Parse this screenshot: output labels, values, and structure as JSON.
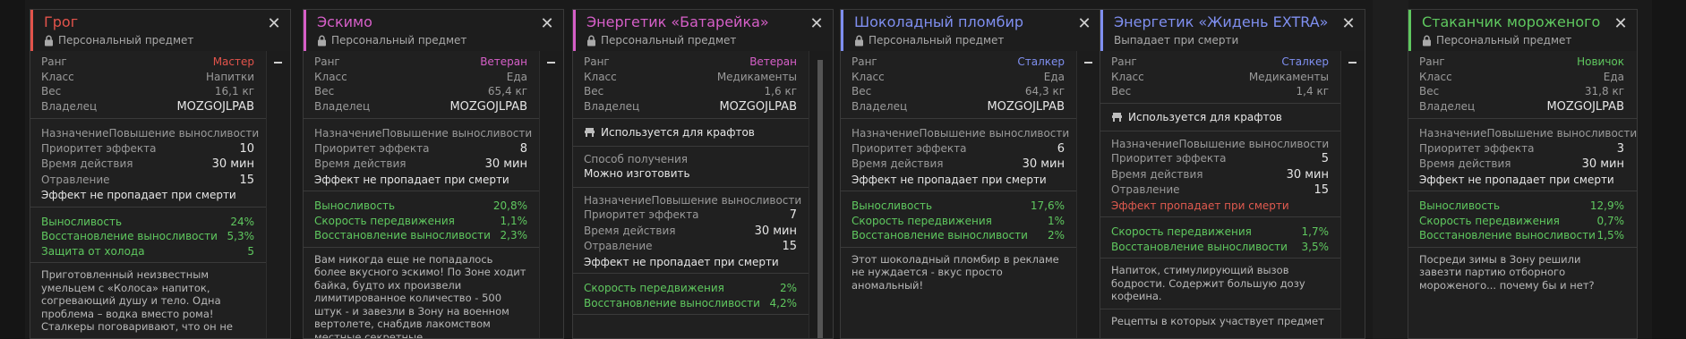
{
  "cards": [
    {
      "title": "Грог",
      "subtitle": "Персональный предмет",
      "accent": "#e2534b",
      "rank": {
        "key": "Ранг",
        "value": "Мастер",
        "color": "#e2534b"
      },
      "klass": {
        "key": "Класс",
        "value": "Напитки"
      },
      "weight": {
        "key": "Вес",
        "value": "16,1 кг"
      },
      "owner": {
        "key": "Владелец",
        "value": "MOZGOJLPAB"
      },
      "purpose": {
        "key": "Назначение",
        "value": "Повышение выносливости"
      },
      "priority": {
        "key": "Приоритет эффекта",
        "value": "10"
      },
      "duration": {
        "key": "Время действия",
        "value": "30 мин"
      },
      "poison": {
        "key": "Отравление",
        "value": "15"
      },
      "note": "Эффект не пропадает при смерти",
      "stats": [
        {
          "key": "Выносливость",
          "value": "24%"
        },
        {
          "key": "Восстановление выносливости",
          "value": "5,3%"
        },
        {
          "key": "Защита от холода",
          "value": "5"
        }
      ],
      "desc": "Приготовленный неизвестным умельцем с «Колоса» напиток, согревающий душу и тело. Одна проблема – водка вместо рома! Сталкеры поговаривают, что он не"
    },
    {
      "title": "Эскимо",
      "subtitle": "Персональный предмет",
      "accent": "#d65fc8",
      "rank": {
        "key": "Ранг",
        "value": "Ветеран",
        "color": "#d65fc8"
      },
      "klass": {
        "key": "Класс",
        "value": "Еда"
      },
      "weight": {
        "key": "Вес",
        "value": "65,4 кг"
      },
      "owner": {
        "key": "Владелец",
        "value": "MOZGOJLPAB"
      },
      "purpose": {
        "key": "Назначение",
        "value": "Повышение выносливости"
      },
      "priority": {
        "key": "Приоритет эффекта",
        "value": "8"
      },
      "duration": {
        "key": "Время действия",
        "value": "30 мин"
      },
      "note": "Эффект не пропадает при смерти",
      "stats": [
        {
          "key": "Выносливость",
          "value": "20,8%"
        },
        {
          "key": "Скорость передвижения",
          "value": "1,1%"
        },
        {
          "key": "Восстановление выносливости",
          "value": "2,3%"
        }
      ],
      "desc": "Вам никогда еще не попадалось более вкусного эскимо! По Зоне ходит байка, будто их произвели лимитированное количество - 500 штук - и завезли в Зону на военном вертолете, снабдив лакомством местные секретные"
    },
    {
      "title": "Энергетик «Батарейка»",
      "subtitle": "Персональный предмет",
      "accent": "#d65fc8",
      "rank": {
        "key": "Ранг",
        "value": "Ветеран",
        "color": "#d65fc8"
      },
      "klass": {
        "key": "Класс",
        "value": "Медикаменты"
      },
      "weight": {
        "key": "Вес",
        "value": "1,6 кг"
      },
      "owner": {
        "key": "Владелец",
        "value": "MOZGOJLPAB"
      },
      "craft": "Используется для крафтов",
      "obtain": {
        "label": "Способ получения",
        "value": "Можно изготовить"
      },
      "purpose": {
        "key": "Назначение",
        "value": "Повышение выносливости"
      },
      "priority": {
        "key": "Приоритет эффекта",
        "value": "7"
      },
      "duration": {
        "key": "Время действия",
        "value": "30 мин"
      },
      "poison": {
        "key": "Отравление",
        "value": "15"
      },
      "note": "Эффект не пропадает при смерти",
      "stats": [
        {
          "key": "Скорость передвижения",
          "value": "2%"
        },
        {
          "key": "Восстановление выносливости",
          "value": "4,2%"
        }
      ]
    },
    {
      "title": "Шоколадный пломбир",
      "subtitle": "Персональный предмет",
      "accent": "#7f8ff0",
      "rank": {
        "key": "Ранг",
        "value": "Сталкер",
        "color": "#7f8ff0"
      },
      "klass": {
        "key": "Класс",
        "value": "Еда"
      },
      "weight": {
        "key": "Вес",
        "value": "64,3 кг"
      },
      "owner": {
        "key": "Владелец",
        "value": "MOZGOJLPAB"
      },
      "purpose": {
        "key": "Назначение",
        "value": "Повышение выносливости"
      },
      "priority": {
        "key": "Приоритет эффекта",
        "value": "6"
      },
      "duration": {
        "key": "Время действия",
        "value": "30 мин"
      },
      "note": "Эффект не пропадает при смерти",
      "stats": [
        {
          "key": "Выносливость",
          "value": "17,6%"
        },
        {
          "key": "Скорость передвижения",
          "value": "1%"
        },
        {
          "key": "Восстановление выносливости",
          "value": "2%"
        }
      ],
      "desc": "Этот шоколадный пломбир в рекламе не нуждается - вкус просто аномальный!"
    },
    {
      "title": "Энергетик «Жидень EXTRA»",
      "subtitle": "Выпадает при смерти",
      "accent": "#7f8ff0",
      "rank": {
        "key": "Ранг",
        "value": "Сталкер",
        "color": "#7f8ff0"
      },
      "klass": {
        "key": "Класс",
        "value": "Медикаменты"
      },
      "weight": {
        "key": "Вес",
        "value": "1,4 кг"
      },
      "craft": "Используется для крафтов",
      "purpose": {
        "key": "Назначение",
        "value": "Повышение выносливости"
      },
      "priority": {
        "key": "Приоритет эффекта",
        "value": "5"
      },
      "duration": {
        "key": "Время действия",
        "value": "30 мин"
      },
      "poison": {
        "key": "Отравление",
        "value": "15"
      },
      "note_red": "Эффект пропадает при смерти",
      "stats": [
        {
          "key": "Скорость передвижения",
          "value": "1,7%"
        },
        {
          "key": "Восстановление выносливости",
          "value": "3,5%"
        }
      ],
      "desc": "Напиток, стимулирующий вызов бодрости. Содержит большую дозу кофеина.",
      "recipes": "Рецепты в которых участвует предмет"
    },
    {
      "title": "Стаканчик мороженого",
      "subtitle": "Персональный предмет",
      "accent": "#5fc85f",
      "rank": {
        "key": "Ранг",
        "value": "Новичок",
        "color": "#5fc85f"
      },
      "klass": {
        "key": "Класс",
        "value": "Еда"
      },
      "weight": {
        "key": "Вес",
        "value": "31,8 кг"
      },
      "owner": {
        "key": "Владелец",
        "value": "MOZGOJLPAB"
      },
      "purpose": {
        "key": "Назначение",
        "value": "Повышение выносливости"
      },
      "priority": {
        "key": "Приоритет эффекта",
        "value": "3"
      },
      "duration": {
        "key": "Время действия",
        "value": "30 мин"
      },
      "note": "Эффект не пропадает при смерти",
      "stats": [
        {
          "key": "Выносливость",
          "value": "12,9%"
        },
        {
          "key": "Скорость передвижения",
          "value": "0,7%"
        },
        {
          "key": "Восстановление выносливости",
          "value": "1,5%"
        }
      ],
      "desc": "Посреди зимы в Зону решили завезти партию отборного мороженого... почему бы и нет?"
    }
  ]
}
